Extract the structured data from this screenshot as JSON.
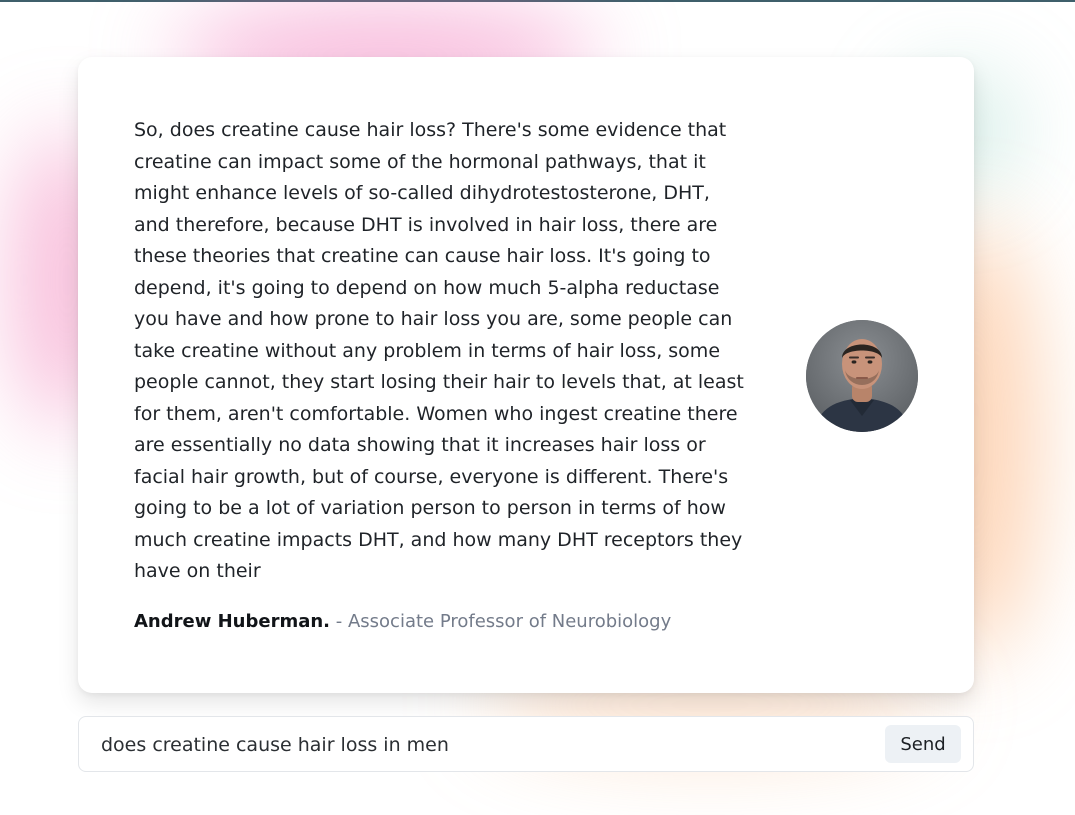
{
  "quote": {
    "text": "So, does creatine cause hair loss? There's some evidence that creatine can impact some of the hormonal pathways, that it might enhance levels of so-called dihydrotestosterone, DHT, and therefore, because DHT is involved in hair loss, there are these theories that creatine can cause hair loss. It's going to depend, it's going to depend on how much 5-alpha reductase you have and how prone to hair loss you are, some people can take creatine without any problem in terms of hair loss, some people cannot, they start losing their hair to levels that, at least for them, aren't comfortable. Women who ingest creatine there are essentially no data showing that it increases hair loss or facial hair growth, but of course, everyone is different. There's going to be a lot of variation person to person in terms of how much creatine impacts DHT, and how many DHT receptors they have on their"
  },
  "author": {
    "name": "Andrew Huberman.",
    "title": "- Associate Professor of Neurobiology"
  },
  "search": {
    "value": "does creatine cause hair loss in men",
    "send_label": "Send"
  },
  "colors": {
    "top_rule": "#3f5f6b",
    "glow_pink": "#f078b9",
    "glow_orange": "#faa564",
    "author_title": "#737b8a",
    "send_button_bg": "#edf1f5"
  }
}
